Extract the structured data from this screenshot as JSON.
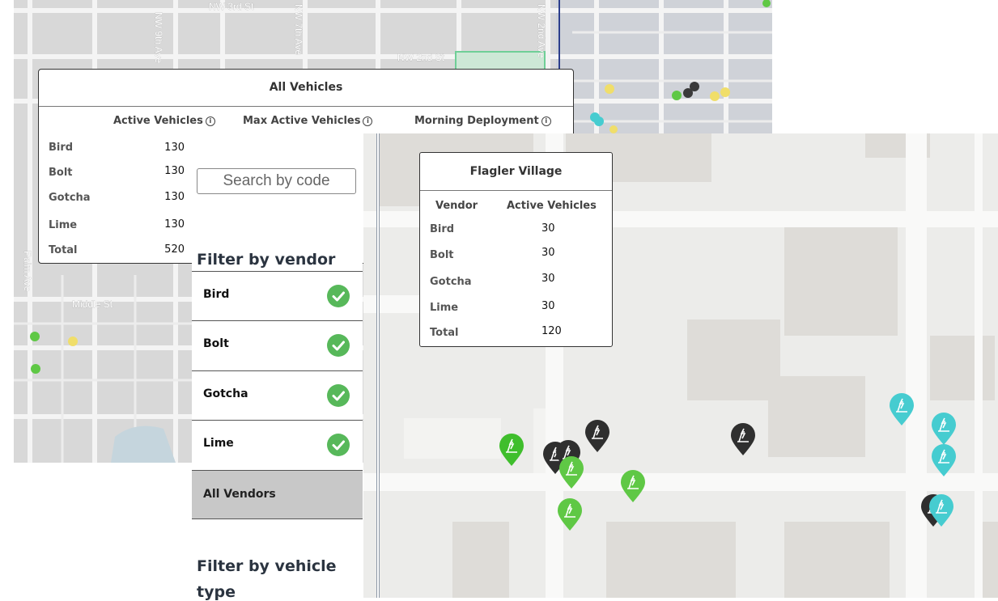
{
  "back_map": {
    "streets": {
      "nw_3rd_st": "NW 3rd St",
      "nw_9th_ave": "NW 9th Ave",
      "nw_7th_ave": "NW 7th Ave",
      "nw_2nd_st": "NW 2nd St",
      "nw_2nd_ave": "NW 2nd Ave",
      "palm_ave": "Palm Ave",
      "middle_st": "Middle St"
    }
  },
  "all_vehicles": {
    "title": "All Vehicles",
    "columns": [
      "Active Vehicles",
      "Max Active Vehicles",
      "Morning Deployment"
    ],
    "rows": [
      {
        "vendor": "Bird",
        "active": "130"
      },
      {
        "vendor": "Bolt",
        "active": "130"
      },
      {
        "vendor": "Gotcha",
        "active": "130"
      },
      {
        "vendor": "Lime",
        "active": "130"
      },
      {
        "vendor": "Total",
        "active": "520"
      }
    ]
  },
  "sidebar": {
    "search_placeholder": "Search by code",
    "filter_vendor_heading": "Filter by vendor",
    "vendors": [
      "Bird",
      "Bolt",
      "Gotcha",
      "Lime"
    ],
    "all_vendors_label": "All Vendors",
    "filter_type_heading_line1": "Filter by vehicle",
    "filter_type_heading_line2": "type"
  },
  "flagler": {
    "title": "Flagler Village",
    "columns": [
      "Vendor",
      "Active Vehicles"
    ],
    "rows": [
      {
        "vendor": "Bird",
        "active": "30"
      },
      {
        "vendor": "Bolt",
        "active": "30"
      },
      {
        "vendor": "Gotcha",
        "active": "30"
      },
      {
        "vendor": "Lime",
        "active": "30"
      },
      {
        "vendor": "Total",
        "active": "120"
      }
    ]
  },
  "colors": {
    "bird": "#2f2f2f",
    "bolt": "#5fc845",
    "gotcha": "#46ccd0",
    "lime": "#3fbe2c",
    "check": "#57b85a"
  }
}
